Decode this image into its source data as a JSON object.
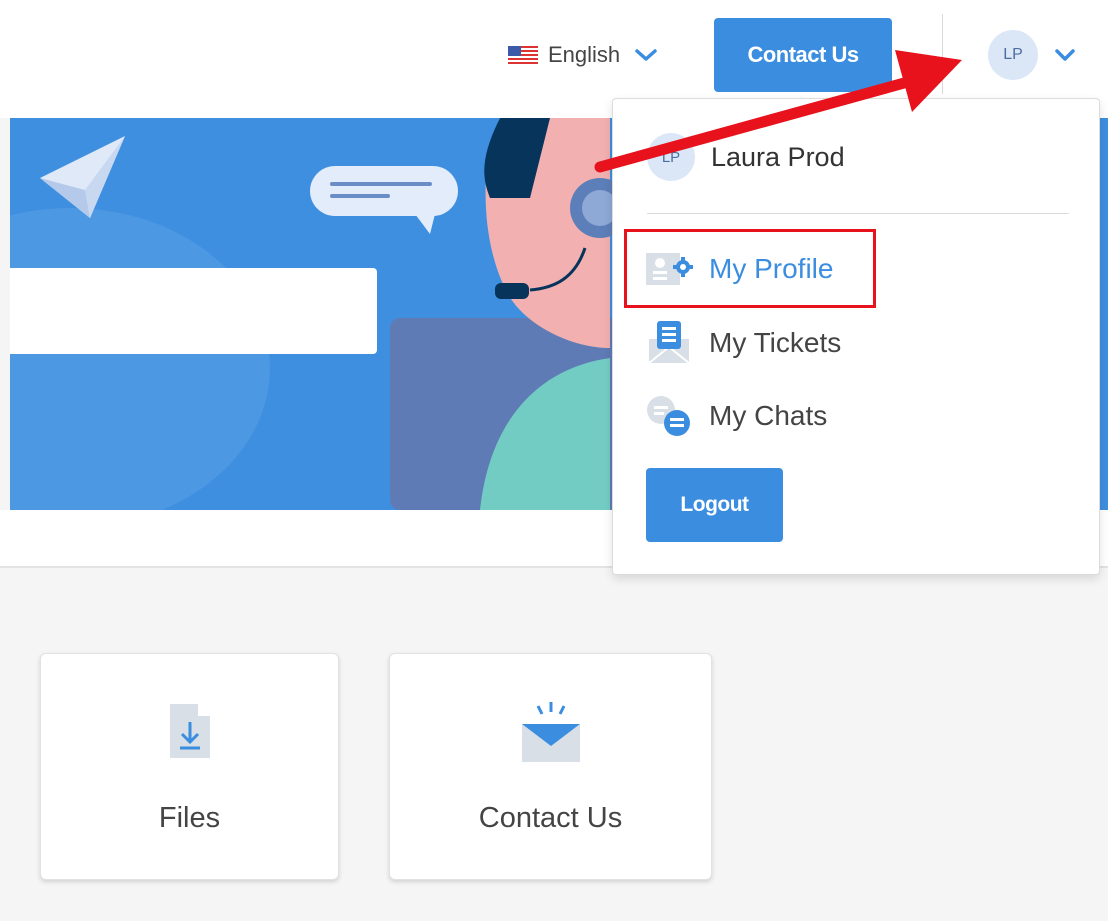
{
  "header": {
    "language": {
      "label": "English",
      "flag_icon": "us-flag-icon"
    },
    "contact_button": "Contact Us",
    "user": {
      "initials": "LP"
    }
  },
  "dropdown": {
    "user": {
      "initials": "LP",
      "name": "Laura Prod"
    },
    "items": [
      {
        "label": "My Profile",
        "icon": "profile-settings-icon",
        "active": true
      },
      {
        "label": "My Tickets",
        "icon": "tickets-icon",
        "active": false
      },
      {
        "label": "My Chats",
        "icon": "chats-icon",
        "active": false
      }
    ],
    "logout": "Logout"
  },
  "cards": [
    {
      "label": "Files",
      "icon": "file-download-icon"
    },
    {
      "label": "Contact Us",
      "icon": "mail-icon"
    }
  ],
  "colors": {
    "accent": "#3b8de0",
    "hero_background": "#3e8fe0",
    "annotation": "#e8121c"
  }
}
